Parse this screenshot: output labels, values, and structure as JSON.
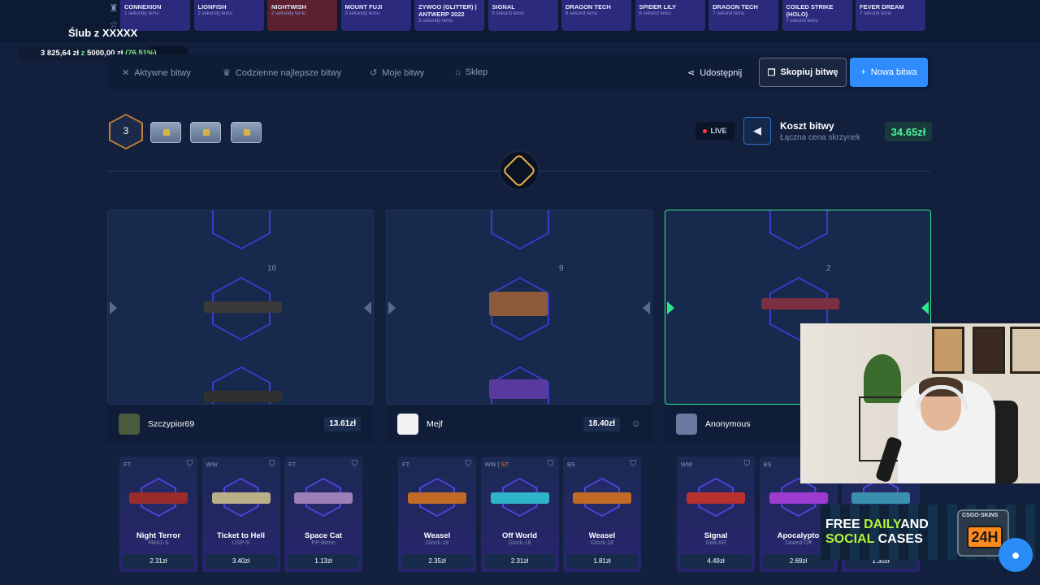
{
  "feed": {
    "side_icons": [
      "trophy-icon",
      "star-icon"
    ],
    "items": [
      {
        "name": "CONNEXION",
        "time": "1 sekundę temu"
      },
      {
        "name": "LIONFISH",
        "time": "2 sekundy temu"
      },
      {
        "name": "NIGHTWISH",
        "time": "2 sekundy temu"
      },
      {
        "name": "MOUNT FUJI",
        "time": "3 sekundy temu"
      },
      {
        "name": "ZYWOO (GLITTER) | ANTWERP 2022",
        "time": "3 sekundy temu"
      },
      {
        "name": "SIGNAL",
        "time": "5 sekund temu"
      },
      {
        "name": "DRAGON TECH",
        "time": "6 sekund temu"
      },
      {
        "name": "SPIDER LILY",
        "time": "6 sekund temu"
      },
      {
        "name": "DRAGON TECH",
        "time": "7 sekund temu"
      },
      {
        "name": "COILED STRIKE (HOLO)",
        "time": "7 sekund temu"
      },
      {
        "name": "FEVER DREAM",
        "time": "7 sekund temu"
      }
    ]
  },
  "goal": {
    "title": "Ślub z XXXXX",
    "current": "3 825,64 zł",
    "z": "z",
    "target": "5000,00 zł",
    "percent": "(76.51%)",
    "progress": 0.7651
  },
  "nav": {
    "active": "Aktywne bitwy",
    "daily": "Codzienne najlepsze bitwy",
    "mine": "Moje bitwy",
    "shop": "Sklep",
    "share": "Udostępnij",
    "copy": "Skopiuj bitwę",
    "new": "Nowa bitwa",
    "new_plus": "+"
  },
  "battle": {
    "rounds": "3",
    "live": "LIVE",
    "cost_title": "Koszt bitwy",
    "cost_sub": "Łączna cena skrzynek",
    "cost_value": "34.65zł"
  },
  "slots": [
    {
      "count": "16"
    },
    {
      "count": "9"
    },
    {
      "count": "2"
    }
  ],
  "players": [
    {
      "name": "Szczypior69",
      "value": "13.61zł",
      "drops": [
        {
          "cond": "FT",
          "name": "Night Terror",
          "type": "M4A1-S",
          "price": "2.31zł",
          "color": "#9a2b2b"
        },
        {
          "cond": "WW",
          "name": "Ticket to Hell",
          "type": "USP-S",
          "price": "3.40zł",
          "color": "#b9b08a"
        },
        {
          "cond": "FT",
          "name": "Space Cat",
          "type": "PP-Bizon",
          "price": "1.13zł",
          "color": "#9c7fb6"
        }
      ]
    },
    {
      "name": "Mejf",
      "value": "18.40zł",
      "drops": [
        {
          "cond": "FT",
          "name": "Weasel",
          "type": "Glock-18",
          "price": "2.35zł",
          "color": "#c06a25"
        },
        {
          "cond": "WW |",
          "cond_st": "ST",
          "name": "Off World",
          "type": "Glock-18",
          "price": "2.31zł",
          "color": "#2fb3c9"
        },
        {
          "cond": "BS",
          "name": "Weasel",
          "type": "Glock-18",
          "price": "1.81zł",
          "color": "#c06a25"
        }
      ]
    },
    {
      "name": "Anonymous",
      "value": "",
      "drops": [
        {
          "cond": "WW",
          "name": "Signal",
          "type": "Galil AR",
          "price": "4.49zł",
          "color": "#b8312f"
        },
        {
          "cond": "BS",
          "name": "Apocalypto",
          "type": "Sawed-Off",
          "price": "2.69zł",
          "color": "#9b3bd0"
        },
        {
          "cond": "",
          "name": "",
          "type": "",
          "price": "1.30zł",
          "color": "#3a8fb0"
        }
      ]
    }
  ],
  "banner": {
    "free": "FREE ",
    "daily": "DAILY",
    "and": "AND",
    "social": "SOCIAL ",
    "cases": "CASES",
    "badge_label": "CSGO·SKINS",
    "badge_value": "24H"
  },
  "colors": {
    "accent": "#2f8cff",
    "win": "#2ee88a",
    "cost": "#4df59b",
    "rare": "#3d3ad0"
  }
}
